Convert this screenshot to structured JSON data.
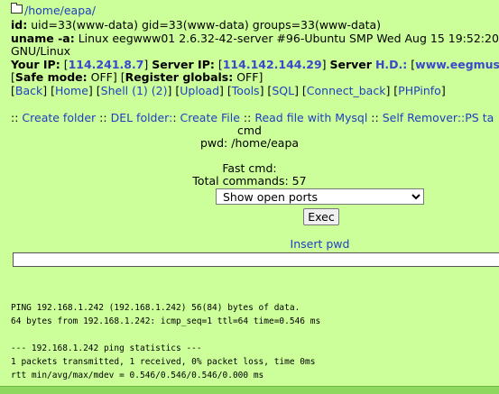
{
  "path_link": "/home/eapa/",
  "id_label": "id:",
  "id_value": " uid=33(www-data) gid=33(www-data) groups=33(www-data)",
  "uname_label": "uname -a:",
  "uname_value": " Linux eegwww01 2.6.32-42-server #96-Ubuntu SMP Wed Aug 15 19:52:20",
  "uname_cont": "GNU/Linux",
  "your_ip_label": "Your IP:",
  "your_ip_value": "114.241.8.7",
  "server_ip_label": "Server IP:",
  "server_ip_value": "114.142.144.29",
  "server_label": "Server",
  "hd_value": "H.D.:",
  "server_host": "www.eegmus",
  "safe_mode_label": "Safe mode:",
  "safe_mode_value": " OFF]",
  "register_globals_label": "Register globals:",
  "register_globals_value": " OFF]",
  "nav_links": [
    "Back",
    "Home",
    "Shell (1) (2)",
    "Upload",
    "Tools",
    "SQL",
    "Connect_back",
    "PHPinfo"
  ],
  "action_links": [
    "Create folder",
    "DEL folder:",
    "Create File",
    "Read file with Mysql",
    "Self Remover::PS ta"
  ],
  "cmd_label": "cmd",
  "pwd_label": "pwd: /home/eapa",
  "fast_cmd_label": "Fast cmd:",
  "total_commands": "Total commands: 57",
  "fast_cmd_selected": "Show open ports",
  "exec_button": "Exec",
  "insert_pwd": "Insert pwd",
  "cmd_input_value": "",
  "output": "PING 192.168.1.242 (192.168.1.242) 56(84) bytes of data.\n64 bytes from 192.168.1.242: icmp_seq=1 ttl=64 time=0.546 ms\n\n--- 192.168.1.242 ping statistics ---\n1 packets transmitted, 1 received, 0% packet loss, time 0ms\nrtt min/avg/max/mdev = 0.546/0.546/0.546/0.000 ms",
  "colors": {
    "background": "#ccff99",
    "link": "#1f3fbf",
    "bottom_bar": "#8fd85f"
  }
}
